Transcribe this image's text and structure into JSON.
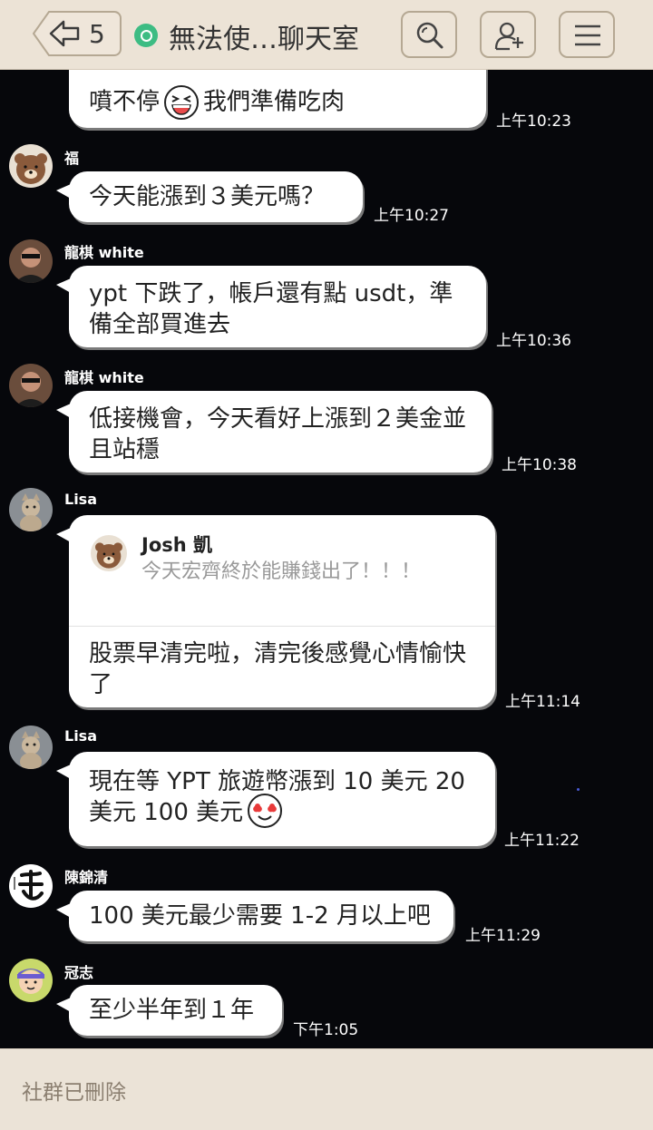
{
  "header": {
    "unread_count": "5",
    "title": "無法使…聊天室",
    "icons": [
      "back-arrow-icon",
      "open-chat-icon",
      "search-icon",
      "add-friend-icon",
      "menu-icon"
    ]
  },
  "messages": [
    {
      "text_line1": "噴不停",
      "text_line1b": "我們準備吃肉",
      "time": "上午10:23"
    },
    {
      "sender": "福",
      "text": "今天能漲到３美元嗎？",
      "time": "上午10:27"
    },
    {
      "sender": "龍棋 white",
      "text": "ypt 下跌了，帳戶還有點 usdt，準備全部買進去",
      "time": "上午10:36"
    },
    {
      "sender": "龍棋 white",
      "text": "低接機會，今天看好上漲到２美金並且站穩",
      "time": "上午10:38"
    },
    {
      "sender": "Lisa",
      "quote_name": "Josh 凱",
      "quote_text": "今天宏齊終於能賺錢出了！！！",
      "text": "股票早清完啦，清完後感覺心情愉快了",
      "time": "上午11:14"
    },
    {
      "sender": "Lisa",
      "text": "現在等 YPT 旅遊幣漲到 10 美元 20 美元 100 美元",
      "time": "上午11:22"
    },
    {
      "sender": "陳錦清",
      "text": "100 美元最少需要 1-2 月以上吧",
      "time": "上午11:29"
    },
    {
      "sender": "冠志",
      "text": "至少半年到１年",
      "time": "下午1:05"
    }
  ],
  "footer": {
    "text": "社群已刪除"
  },
  "colors": {
    "header_bg": "#ece3d6",
    "chat_bg": "#06070b",
    "bubble": "#ffffff",
    "badge_green": "#3dbc83"
  }
}
